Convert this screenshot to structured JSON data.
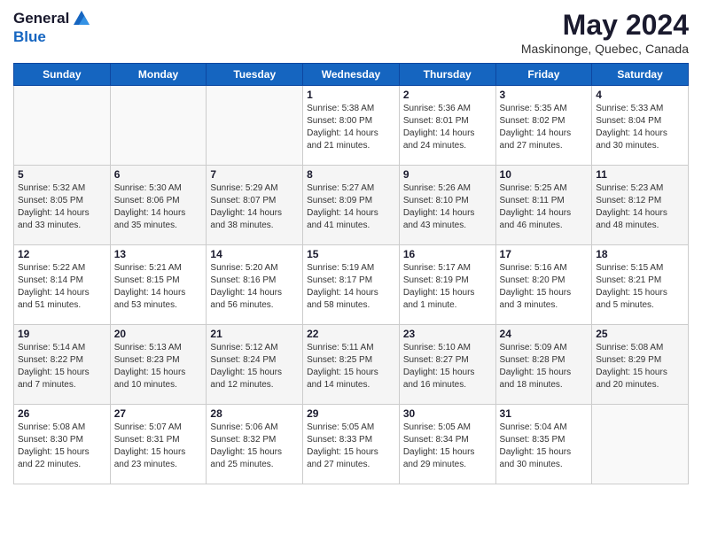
{
  "logo": {
    "general": "General",
    "blue": "Blue"
  },
  "title": {
    "month_year": "May 2024",
    "location": "Maskinonge, Quebec, Canada"
  },
  "weekdays": [
    "Sunday",
    "Monday",
    "Tuesday",
    "Wednesday",
    "Thursday",
    "Friday",
    "Saturday"
  ],
  "weeks": [
    [
      {
        "day": "",
        "info": ""
      },
      {
        "day": "",
        "info": ""
      },
      {
        "day": "",
        "info": ""
      },
      {
        "day": "1",
        "info": "Sunrise: 5:38 AM\nSunset: 8:00 PM\nDaylight: 14 hours\nand 21 minutes."
      },
      {
        "day": "2",
        "info": "Sunrise: 5:36 AM\nSunset: 8:01 PM\nDaylight: 14 hours\nand 24 minutes."
      },
      {
        "day": "3",
        "info": "Sunrise: 5:35 AM\nSunset: 8:02 PM\nDaylight: 14 hours\nand 27 minutes."
      },
      {
        "day": "4",
        "info": "Sunrise: 5:33 AM\nSunset: 8:04 PM\nDaylight: 14 hours\nand 30 minutes."
      }
    ],
    [
      {
        "day": "5",
        "info": "Sunrise: 5:32 AM\nSunset: 8:05 PM\nDaylight: 14 hours\nand 33 minutes."
      },
      {
        "day": "6",
        "info": "Sunrise: 5:30 AM\nSunset: 8:06 PM\nDaylight: 14 hours\nand 35 minutes."
      },
      {
        "day": "7",
        "info": "Sunrise: 5:29 AM\nSunset: 8:07 PM\nDaylight: 14 hours\nand 38 minutes."
      },
      {
        "day": "8",
        "info": "Sunrise: 5:27 AM\nSunset: 8:09 PM\nDaylight: 14 hours\nand 41 minutes."
      },
      {
        "day": "9",
        "info": "Sunrise: 5:26 AM\nSunset: 8:10 PM\nDaylight: 14 hours\nand 43 minutes."
      },
      {
        "day": "10",
        "info": "Sunrise: 5:25 AM\nSunset: 8:11 PM\nDaylight: 14 hours\nand 46 minutes."
      },
      {
        "day": "11",
        "info": "Sunrise: 5:23 AM\nSunset: 8:12 PM\nDaylight: 14 hours\nand 48 minutes."
      }
    ],
    [
      {
        "day": "12",
        "info": "Sunrise: 5:22 AM\nSunset: 8:14 PM\nDaylight: 14 hours\nand 51 minutes."
      },
      {
        "day": "13",
        "info": "Sunrise: 5:21 AM\nSunset: 8:15 PM\nDaylight: 14 hours\nand 53 minutes."
      },
      {
        "day": "14",
        "info": "Sunrise: 5:20 AM\nSunset: 8:16 PM\nDaylight: 14 hours\nand 56 minutes."
      },
      {
        "day": "15",
        "info": "Sunrise: 5:19 AM\nSunset: 8:17 PM\nDaylight: 14 hours\nand 58 minutes."
      },
      {
        "day": "16",
        "info": "Sunrise: 5:17 AM\nSunset: 8:19 PM\nDaylight: 15 hours\nand 1 minute."
      },
      {
        "day": "17",
        "info": "Sunrise: 5:16 AM\nSunset: 8:20 PM\nDaylight: 15 hours\nand 3 minutes."
      },
      {
        "day": "18",
        "info": "Sunrise: 5:15 AM\nSunset: 8:21 PM\nDaylight: 15 hours\nand 5 minutes."
      }
    ],
    [
      {
        "day": "19",
        "info": "Sunrise: 5:14 AM\nSunset: 8:22 PM\nDaylight: 15 hours\nand 7 minutes."
      },
      {
        "day": "20",
        "info": "Sunrise: 5:13 AM\nSunset: 8:23 PM\nDaylight: 15 hours\nand 10 minutes."
      },
      {
        "day": "21",
        "info": "Sunrise: 5:12 AM\nSunset: 8:24 PM\nDaylight: 15 hours\nand 12 minutes."
      },
      {
        "day": "22",
        "info": "Sunrise: 5:11 AM\nSunset: 8:25 PM\nDaylight: 15 hours\nand 14 minutes."
      },
      {
        "day": "23",
        "info": "Sunrise: 5:10 AM\nSunset: 8:27 PM\nDaylight: 15 hours\nand 16 minutes."
      },
      {
        "day": "24",
        "info": "Sunrise: 5:09 AM\nSunset: 8:28 PM\nDaylight: 15 hours\nand 18 minutes."
      },
      {
        "day": "25",
        "info": "Sunrise: 5:08 AM\nSunset: 8:29 PM\nDaylight: 15 hours\nand 20 minutes."
      }
    ],
    [
      {
        "day": "26",
        "info": "Sunrise: 5:08 AM\nSunset: 8:30 PM\nDaylight: 15 hours\nand 22 minutes."
      },
      {
        "day": "27",
        "info": "Sunrise: 5:07 AM\nSunset: 8:31 PM\nDaylight: 15 hours\nand 23 minutes."
      },
      {
        "day": "28",
        "info": "Sunrise: 5:06 AM\nSunset: 8:32 PM\nDaylight: 15 hours\nand 25 minutes."
      },
      {
        "day": "29",
        "info": "Sunrise: 5:05 AM\nSunset: 8:33 PM\nDaylight: 15 hours\nand 27 minutes."
      },
      {
        "day": "30",
        "info": "Sunrise: 5:05 AM\nSunset: 8:34 PM\nDaylight: 15 hours\nand 29 minutes."
      },
      {
        "day": "31",
        "info": "Sunrise: 5:04 AM\nSunset: 8:35 PM\nDaylight: 15 hours\nand 30 minutes."
      },
      {
        "day": "",
        "info": ""
      }
    ]
  ]
}
